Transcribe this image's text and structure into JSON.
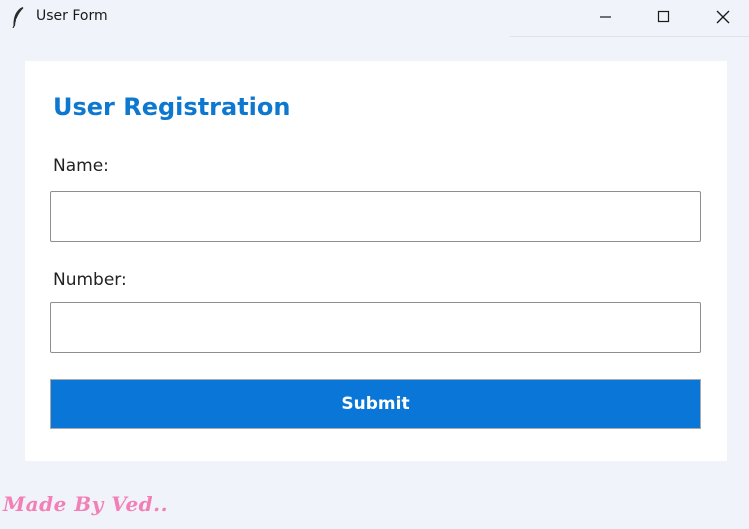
{
  "window": {
    "title": "User Form",
    "icon": "feather-icon",
    "controls": [
      "minimize-icon",
      "maximize-icon",
      "close-icon"
    ]
  },
  "form": {
    "heading": "User Registration",
    "heading_color": "#0e78d0",
    "fields": {
      "name": {
        "label": "Name:",
        "value": "",
        "placeholder": ""
      },
      "number": {
        "label": "Number:",
        "value": "",
        "placeholder": ""
      }
    },
    "submit_label": "Submit",
    "submit_color": "#0a77d8"
  },
  "footer": {
    "credit": "Made By Ved..",
    "credit_color": "#f27fb6"
  },
  "colors": {
    "background": "#f0f3f9",
    "card": "#ffffff"
  }
}
